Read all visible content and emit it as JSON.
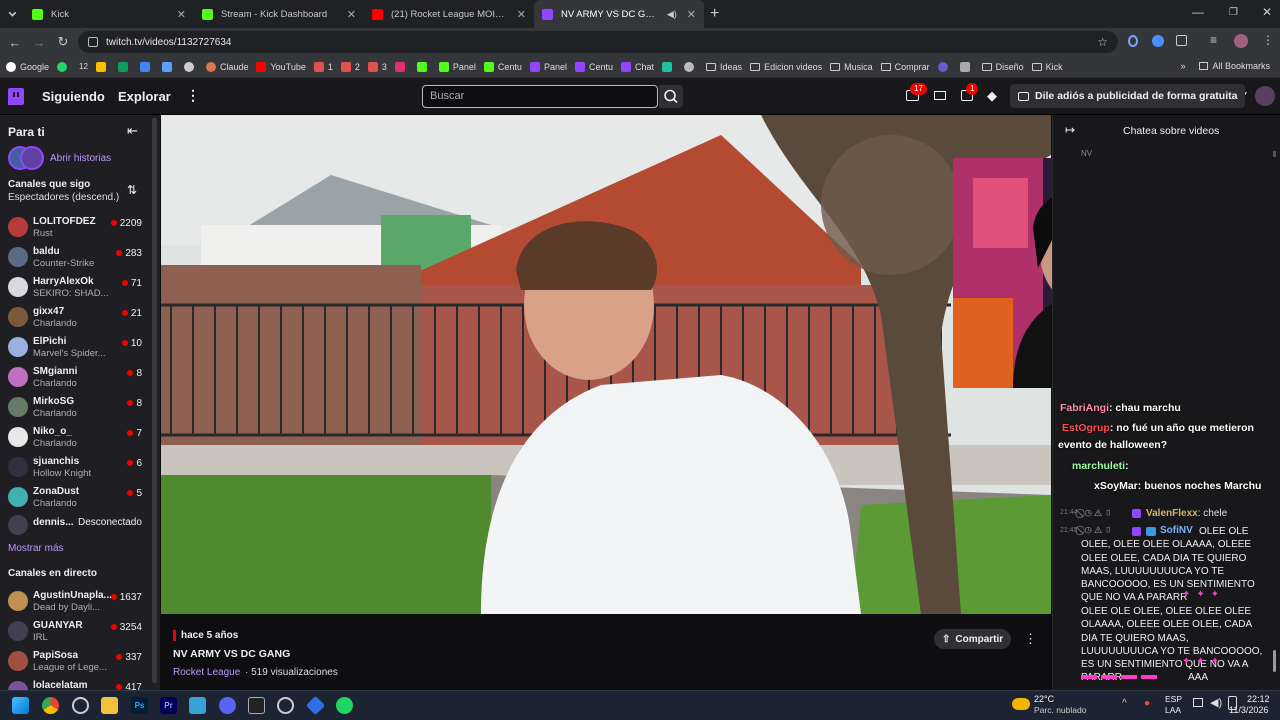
{
  "browser": {
    "tabs": [
      {
        "title": "Kick",
        "color": "#53fc18"
      },
      {
        "title": "Stream - Kick Dashboard",
        "color": "#53fc18"
      },
      {
        "title": "(21) Rocket League MOIMENTS",
        "color": "#ff0000"
      },
      {
        "title": "NV ARMY VS DC GANG - Tw",
        "color": "#9146ff"
      }
    ],
    "url": "twitch.tv/videos/1132727634",
    "bookmarks": [
      "Google",
      "12",
      "Claude",
      "YouTube",
      "1",
      "2",
      "3",
      "Panel",
      "Centu",
      "Panel",
      "Centu",
      "Chat",
      "Ideas",
      "Edicion videos",
      "Musica",
      "Comprar",
      "Diseño",
      "Kick"
    ],
    "all_bookmarks": "All Bookmarks"
  },
  "topnav": {
    "following": "Siguiendo",
    "browse": "Explorar",
    "search_placeholder": "Buscar",
    "inbox_badge": "17",
    "notif_badge": "1",
    "adfree": "Dile adiós a publicidad de forma gratuita"
  },
  "sidebar": {
    "for_you": "Para ti",
    "stories": "Abrir historias",
    "followed_title": "Canales que sigo",
    "sort": "Espectadores (descend.)",
    "followed": [
      {
        "name": "LOLITOFDEZ",
        "game": "Rust",
        "viewers": "2209",
        "color": "#b43c3c"
      },
      {
        "name": "baldu",
        "game": "Counter-Strike",
        "viewers": "283",
        "color": "#5a6a82"
      },
      {
        "name": "HarryAlexOk",
        "game": "SEKIRO: SHAD...",
        "viewers": "71",
        "color": "#d8d8e0"
      },
      {
        "name": "gixx47",
        "game": "Charlando",
        "viewers": "21",
        "color": "#7a5a3a"
      },
      {
        "name": "ElPichi",
        "game": "Marvel's Spider...",
        "viewers": "10",
        "color": "#9ab0e0"
      },
      {
        "name": "SMgianni",
        "game": "Charlando",
        "viewers": "8",
        "color": "#c070c0"
      },
      {
        "name": "MirkoSG",
        "game": "Charlando",
        "viewers": "8",
        "color": "#6a7a6a"
      },
      {
        "name": "Niko_o_",
        "game": "Charlando",
        "viewers": "7",
        "color": "#e8e8e8"
      },
      {
        "name": "sjuanchis",
        "game": "Hollow Knight",
        "viewers": "6",
        "color": "#303040"
      },
      {
        "name": "ZonaDust",
        "game": "Charlando",
        "viewers": "5",
        "color": "#40b0b0"
      }
    ],
    "offline": {
      "name": "dennis...",
      "status": "Desconectado"
    },
    "show_more": "Mostrar más",
    "live_title": "Canales en directo",
    "live": [
      {
        "name": "AgustinUnapla...",
        "game": "Dead by Dayli...",
        "viewers": "1637",
        "color": "#c09050"
      },
      {
        "name": "GUANYAR",
        "game": "IRL",
        "viewers": "3254",
        "color": "#404050"
      },
      {
        "name": "PapiSosa",
        "game": "League of Lege...",
        "viewers": "337",
        "color": "#a05040"
      },
      {
        "name": "lolacelatam",
        "game": "",
        "viewers": "417",
        "color": "#8050a0"
      }
    ]
  },
  "video": {
    "ago": "hace 5 años",
    "title": "NV ARMY VS DC GANG",
    "category": "Rocket League",
    "views": "· 519 visualizaciones",
    "share": "Compartir"
  },
  "chat": {
    "header": "Chatea sobre videos",
    "lines": [
      {
        "user": "FabriAngi",
        "text": ": chau marchu",
        "color": "#ff8fa8"
      },
      {
        "user": "EstOgrup",
        "text": ": no fué un año que metieron",
        "color": "#ff5050"
      },
      {
        "user": "",
        "text": "evento de halloween?",
        "color": "#ffffff"
      },
      {
        "user": "marchuleti",
        "text": ":",
        "color": "#a0ffa0"
      },
      {
        "user": "xSoyMar",
        "text": ": buenos noches Marchu",
        "color": "#ffffff"
      }
    ],
    "t1": "21:44",
    "u1": "ValenFlexx",
    "m1": "chele",
    "t2": "21:45",
    "u2": "SofiNV",
    "m2": "OLEE OLE OLEE, OLEE OLEE OLAAAA, OLEEE OLEE OLEE, CADA DIA TE QUIERO MAAS, LUUUUUUUUCA YO TE BANCOOOOO, ES UN SENTIMIENTO QUE NO VA A PARARR",
    "m3": "OLEE OLE OLEE, OLEE OLEE OLEE OLAAAA, OLEEE OLEE OLEE, CADA DIA TE QUIERO MAAS, LUUUUUUUUCA YO TE BANCOOOOO, ES UN SENTIMIENTO QUE NO VA A PARARR",
    "aaa": "AAA"
  },
  "taskbar": {
    "weather_temp": "22°C",
    "weather_text": "Parc. nublado",
    "lang1": "ESP",
    "lang2": "LAA",
    "time": "22:12",
    "date": "11/3/2026"
  }
}
